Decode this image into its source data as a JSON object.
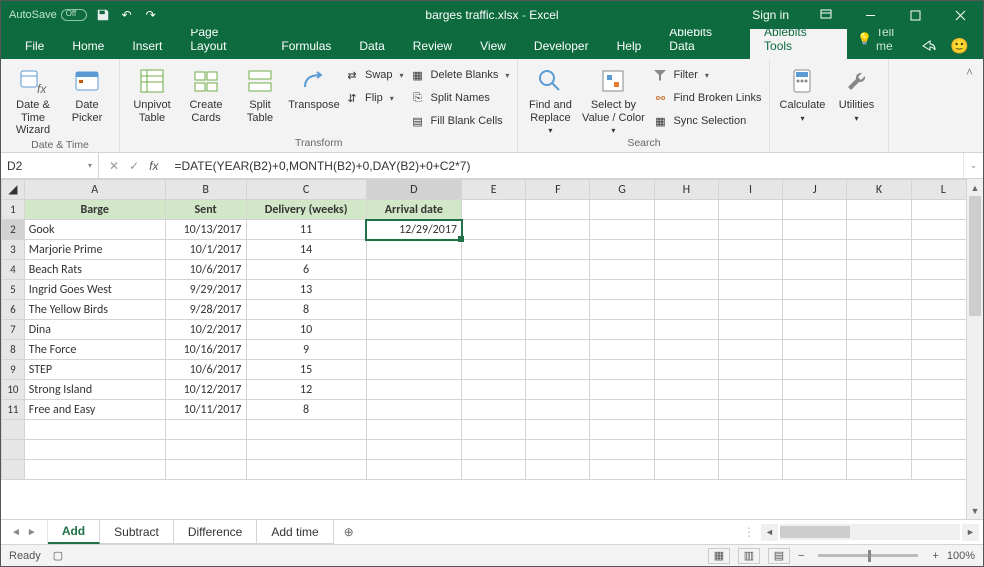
{
  "titlebar": {
    "autosave_label": "AutoSave",
    "filename": "barges traffic.xlsx",
    "app": "Excel",
    "signin": "Sign in"
  },
  "tabs": {
    "file": "File",
    "home": "Home",
    "insert": "Insert",
    "pagelayout": "Page Layout",
    "formulas": "Formulas",
    "data": "Data",
    "review": "Review",
    "view": "View",
    "developer": "Developer",
    "help": "Help",
    "abdata": "Ablebits Data",
    "abtools": "Ablebits Tools",
    "tellme": "Tell me"
  },
  "ribbon": {
    "datetime": {
      "datetime_wizard": "Date & Time Wizard",
      "date_picker": "Date Picker",
      "group": "Date & Time"
    },
    "transform": {
      "unpivot": "Unpivot Table",
      "create_cards": "Create Cards",
      "split_table": "Split Table",
      "transpose": "Transpose",
      "swap": "Swap",
      "flip": "Flip",
      "delete_blanks": "Delete Blanks",
      "split_names": "Split Names",
      "fill_blank": "Fill Blank Cells",
      "group": "Transform"
    },
    "search": {
      "find_replace": "Find and Replace",
      "select_by": "Select by Value / Color",
      "filter": "Filter",
      "find_broken": "Find Broken Links",
      "sync": "Sync Selection",
      "group": "Search"
    },
    "calc": {
      "calculate": "Calculate",
      "utilities": "Utilities"
    }
  },
  "formula_bar": {
    "namebox": "D2",
    "formula": "=DATE(YEAR(B2)+0,MONTH(B2)+0,DAY(B2)+0+C2*7)"
  },
  "headers": {
    "A": "Barge",
    "B": "Sent",
    "C": "Delivery  (weeks)",
    "D": "Arrival date"
  },
  "columns": [
    "A",
    "B",
    "C",
    "D",
    "E",
    "F",
    "G",
    "H",
    "I",
    "J",
    "K",
    "L"
  ],
  "rows": [
    {
      "n": 2,
      "barge": "Gook",
      "sent": "10/13/2017",
      "delivery": "11",
      "arrival": "12/29/2017"
    },
    {
      "n": 3,
      "barge": "Marjorie Prime",
      "sent": "10/1/2017",
      "delivery": "14",
      "arrival": ""
    },
    {
      "n": 4,
      "barge": "Beach Rats",
      "sent": "10/6/2017",
      "delivery": "6",
      "arrival": ""
    },
    {
      "n": 5,
      "barge": "Ingrid Goes West",
      "sent": "9/29/2017",
      "delivery": "13",
      "arrival": ""
    },
    {
      "n": 6,
      "barge": "The Yellow Birds",
      "sent": "9/28/2017",
      "delivery": "8",
      "arrival": ""
    },
    {
      "n": 7,
      "barge": "Dina",
      "sent": "10/2/2017",
      "delivery": "10",
      "arrival": ""
    },
    {
      "n": 8,
      "barge": "The Force",
      "sent": "10/16/2017",
      "delivery": "9",
      "arrival": ""
    },
    {
      "n": 9,
      "barge": "STEP",
      "sent": "10/6/2017",
      "delivery": "15",
      "arrival": ""
    },
    {
      "n": 10,
      "barge": "Strong Island",
      "sent": "10/12/2017",
      "delivery": "12",
      "arrival": ""
    },
    {
      "n": 11,
      "barge": "Free and Easy",
      "sent": "10/11/2017",
      "delivery": "8",
      "arrival": ""
    }
  ],
  "sheets": {
    "add": "Add",
    "subtract": "Subtract",
    "difference": "Difference",
    "addtime": "Add time"
  },
  "status": {
    "ready": "Ready",
    "zoom": "100%"
  },
  "active_cell": "D2"
}
